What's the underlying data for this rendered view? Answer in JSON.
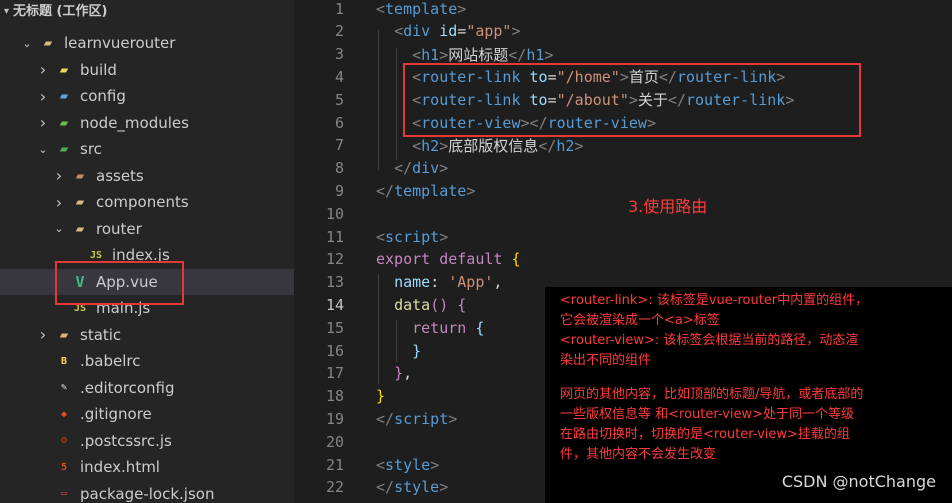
{
  "explorer": {
    "workspace_title": "无标题 (工作区)",
    "items": [
      {
        "label": "learnvuerouter",
        "kind": "folder",
        "depth": 0,
        "expanded": true,
        "icon": "folder-open-icon"
      },
      {
        "label": "build",
        "kind": "folder",
        "depth": 1,
        "expanded": false,
        "icon": "build-folder-icon"
      },
      {
        "label": "config",
        "kind": "folder",
        "depth": 1,
        "expanded": false,
        "icon": "config-folder-icon"
      },
      {
        "label": "node_modules",
        "kind": "folder",
        "depth": 1,
        "expanded": false,
        "icon": "node-folder-icon"
      },
      {
        "label": "src",
        "kind": "folder",
        "depth": 1,
        "expanded": true,
        "icon": "src-folder-icon"
      },
      {
        "label": "assets",
        "kind": "folder",
        "depth": 2,
        "expanded": false,
        "icon": "assets-folder-icon"
      },
      {
        "label": "components",
        "kind": "folder",
        "depth": 2,
        "expanded": false,
        "icon": "folder-icon"
      },
      {
        "label": "router",
        "kind": "folder",
        "depth": 2,
        "expanded": true,
        "icon": "folder-open-icon"
      },
      {
        "label": "index.js",
        "kind": "file",
        "depth": 3,
        "icon": "js-file-icon"
      },
      {
        "label": "App.vue",
        "kind": "file",
        "depth": 2,
        "icon": "vue-file-icon",
        "selected": true
      },
      {
        "label": "main.js",
        "kind": "file",
        "depth": 2,
        "icon": "js-file-icon"
      },
      {
        "label": "static",
        "kind": "folder",
        "depth": 1,
        "expanded": false,
        "icon": "folder-icon"
      },
      {
        "label": ".babelrc",
        "kind": "file",
        "depth": 1,
        "icon": "babel-file-icon"
      },
      {
        "label": ".editorconfig",
        "kind": "file",
        "depth": 1,
        "icon": "editorconfig-file-icon"
      },
      {
        "label": ".gitignore",
        "kind": "file",
        "depth": 1,
        "icon": "git-file-icon"
      },
      {
        "label": ".postcssrc.js",
        "kind": "file",
        "depth": 1,
        "icon": "postcss-file-icon"
      },
      {
        "label": "index.html",
        "kind": "file",
        "depth": 1,
        "icon": "html-file-icon"
      },
      {
        "label": "package-lock.json",
        "kind": "file",
        "depth": 1,
        "icon": "npm-file-icon"
      }
    ]
  },
  "editor": {
    "active_line": 14,
    "lines": [
      {
        "n": "1",
        "tokens": [
          [
            "br",
            "<"
          ],
          [
            "tag",
            "template"
          ],
          [
            "br",
            ">"
          ]
        ]
      },
      {
        "n": "2",
        "tokens": [
          [
            "txt",
            "  "
          ],
          [
            "br",
            "<"
          ],
          [
            "tag",
            "div"
          ],
          [
            "txt",
            " "
          ],
          [
            "attr",
            "id"
          ],
          [
            "txt",
            "="
          ],
          [
            "str",
            "\"app\""
          ],
          [
            "br",
            ">"
          ]
        ]
      },
      {
        "n": "3",
        "tokens": [
          [
            "txt",
            "    "
          ],
          [
            "br",
            "<"
          ],
          [
            "tag",
            "h1"
          ],
          [
            "br",
            ">"
          ],
          [
            "txt",
            "网站标题"
          ],
          [
            "br",
            "</"
          ],
          [
            "tag",
            "h1"
          ],
          [
            "br",
            ">"
          ]
        ]
      },
      {
        "n": "4",
        "tokens": [
          [
            "txt",
            "    "
          ],
          [
            "br",
            "<"
          ],
          [
            "tag",
            "router-link"
          ],
          [
            "txt",
            " "
          ],
          [
            "attr",
            "to"
          ],
          [
            "txt",
            "="
          ],
          [
            "str",
            "\"/home\""
          ],
          [
            "br",
            ">"
          ],
          [
            "txt",
            "首页"
          ],
          [
            "br",
            "</"
          ],
          [
            "tag",
            "router-link"
          ],
          [
            "br",
            ">"
          ]
        ]
      },
      {
        "n": "5",
        "tokens": [
          [
            "txt",
            "    "
          ],
          [
            "br",
            "<"
          ],
          [
            "tag",
            "router-link"
          ],
          [
            "txt",
            " "
          ],
          [
            "attr",
            "to"
          ],
          [
            "txt",
            "="
          ],
          [
            "str",
            "\"/about\""
          ],
          [
            "br",
            ">"
          ],
          [
            "txt",
            "关于"
          ],
          [
            "br",
            "</"
          ],
          [
            "tag",
            "router-link"
          ],
          [
            "br",
            ">"
          ]
        ]
      },
      {
        "n": "6",
        "tokens": [
          [
            "txt",
            "    "
          ],
          [
            "br",
            "<"
          ],
          [
            "tag",
            "router-view"
          ],
          [
            "br",
            "></"
          ],
          [
            "tag",
            "router-view"
          ],
          [
            "br",
            ">"
          ]
        ]
      },
      {
        "n": "7",
        "tokens": [
          [
            "txt",
            "    "
          ],
          [
            "br",
            "<"
          ],
          [
            "tag",
            "h2"
          ],
          [
            "br",
            ">"
          ],
          [
            "txt",
            "底部版权信息"
          ],
          [
            "br",
            "</"
          ],
          [
            "tag",
            "h2"
          ],
          [
            "br",
            ">"
          ]
        ]
      },
      {
        "n": "8",
        "tokens": [
          [
            "txt",
            "  "
          ],
          [
            "br",
            "</"
          ],
          [
            "tag",
            "div"
          ],
          [
            "br",
            ">"
          ]
        ]
      },
      {
        "n": "9",
        "tokens": [
          [
            "br",
            "</"
          ],
          [
            "tag",
            "template"
          ],
          [
            "br",
            ">"
          ]
        ]
      },
      {
        "n": "10",
        "tokens": []
      },
      {
        "n": "11",
        "tokens": [
          [
            "br",
            "<"
          ],
          [
            "tag",
            "script"
          ],
          [
            "br",
            ">"
          ]
        ]
      },
      {
        "n": "12",
        "tokens": [
          [
            "cn",
            "export"
          ],
          [
            "txt",
            " "
          ],
          [
            "cn",
            "default"
          ],
          [
            "txt",
            " "
          ],
          [
            "brace",
            "{"
          ]
        ]
      },
      {
        "n": "13",
        "tokens": [
          [
            "txt",
            "  "
          ],
          [
            "attr",
            "name"
          ],
          [
            "txt",
            ": "
          ],
          [
            "str",
            "'App'"
          ],
          [
            "txt",
            ","
          ]
        ]
      },
      {
        "n": "14",
        "tokens": [
          [
            "txt",
            "  "
          ],
          [
            "fn",
            "data"
          ],
          [
            "cn",
            "()"
          ],
          [
            "txt",
            " "
          ],
          [
            "cn",
            "{"
          ]
        ]
      },
      {
        "n": "15",
        "tokens": [
          [
            "txt",
            "    "
          ],
          [
            "cn",
            "return"
          ],
          [
            "txt",
            " "
          ],
          [
            "attr",
            "{"
          ]
        ]
      },
      {
        "n": "16",
        "tokens": [
          [
            "txt",
            "    "
          ],
          [
            "attr",
            "}"
          ]
        ]
      },
      {
        "n": "17",
        "tokens": [
          [
            "txt",
            "  "
          ],
          [
            "cn",
            "}"
          ],
          [
            "txt",
            ","
          ]
        ]
      },
      {
        "n": "18",
        "tokens": [
          [
            "brace",
            "}"
          ]
        ]
      },
      {
        "n": "19",
        "tokens": [
          [
            "br",
            "</"
          ],
          [
            "tag",
            "script"
          ],
          [
            "br",
            ">"
          ]
        ]
      },
      {
        "n": "20",
        "tokens": []
      },
      {
        "n": "21",
        "tokens": [
          [
            "br",
            "<"
          ],
          [
            "tag",
            "style"
          ],
          [
            "br",
            ">"
          ]
        ]
      },
      {
        "n": "22",
        "tokens": [
          [
            "br",
            "</"
          ],
          [
            "tag",
            "style"
          ],
          [
            "br",
            ">"
          ]
        ]
      }
    ]
  },
  "annotation": {
    "title": "3.使用路由",
    "lines": [
      "<router-link>: 该标签是vue-router中内置的组件，",
      "它会被渲染成一个<a>标签",
      "<router-view>: 该标签会根据当前的路径，动态渲",
      "染出不同的组件",
      "",
      "网页的其他内容，比如顶部的标题/导航，或者底部的",
      "一些版权信息等 和<router-view>处于同一个等级",
      "在路由切换时，切换的是<router-view>挂载的组",
      "件，其他内容不会发生改变"
    ]
  },
  "watermark": "CSDN @notChange",
  "colors": {
    "highlight_box": "#e53935",
    "annotation_text": "#ff3b3b"
  }
}
